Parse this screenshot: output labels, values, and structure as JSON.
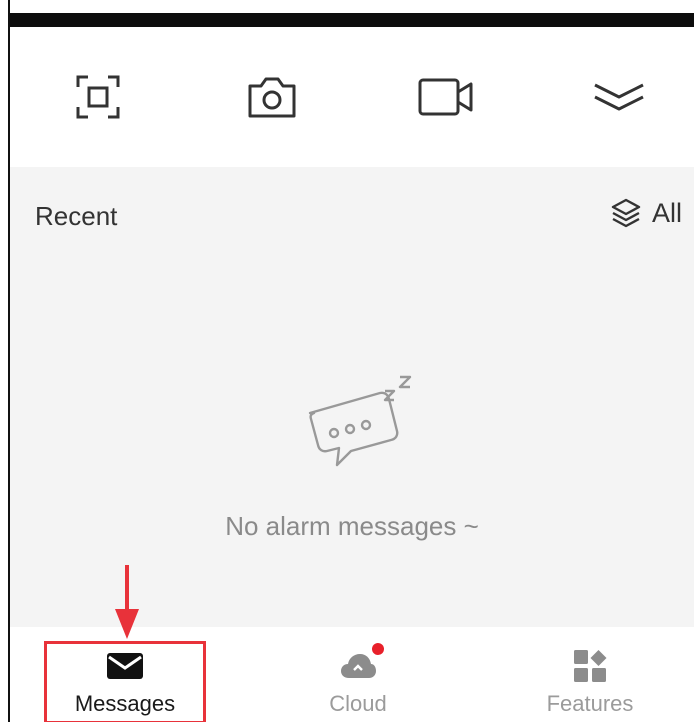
{
  "toolbar": {
    "items": [
      {
        "id": "scan",
        "icon": "scan-frame-icon"
      },
      {
        "id": "camera",
        "icon": "camera-icon"
      },
      {
        "id": "video",
        "icon": "video-camera-icon"
      },
      {
        "id": "more",
        "icon": "double-chevron-down-icon"
      }
    ]
  },
  "recent": {
    "title": "Recent",
    "all_label": "All",
    "all_icon": "layers-icon"
  },
  "empty_state": {
    "icon": "sleeping-message-bubble-icon",
    "message": "No alarm messages ~"
  },
  "tabs": [
    {
      "id": "messages",
      "label": "Messages",
      "icon": "envelope-icon",
      "active": true
    },
    {
      "id": "cloud",
      "label": "Cloud",
      "icon": "cloud-icon",
      "badge": true
    },
    {
      "id": "features",
      "label": "Features",
      "icon": "grid-icon"
    }
  ],
  "colors": {
    "annotation_red": "#e8323a",
    "badge_red": "#e8202a",
    "content_bg": "#f4f4f4",
    "active_tab": "#1a1a1a",
    "inactive_tab": "#9b9b9b"
  }
}
